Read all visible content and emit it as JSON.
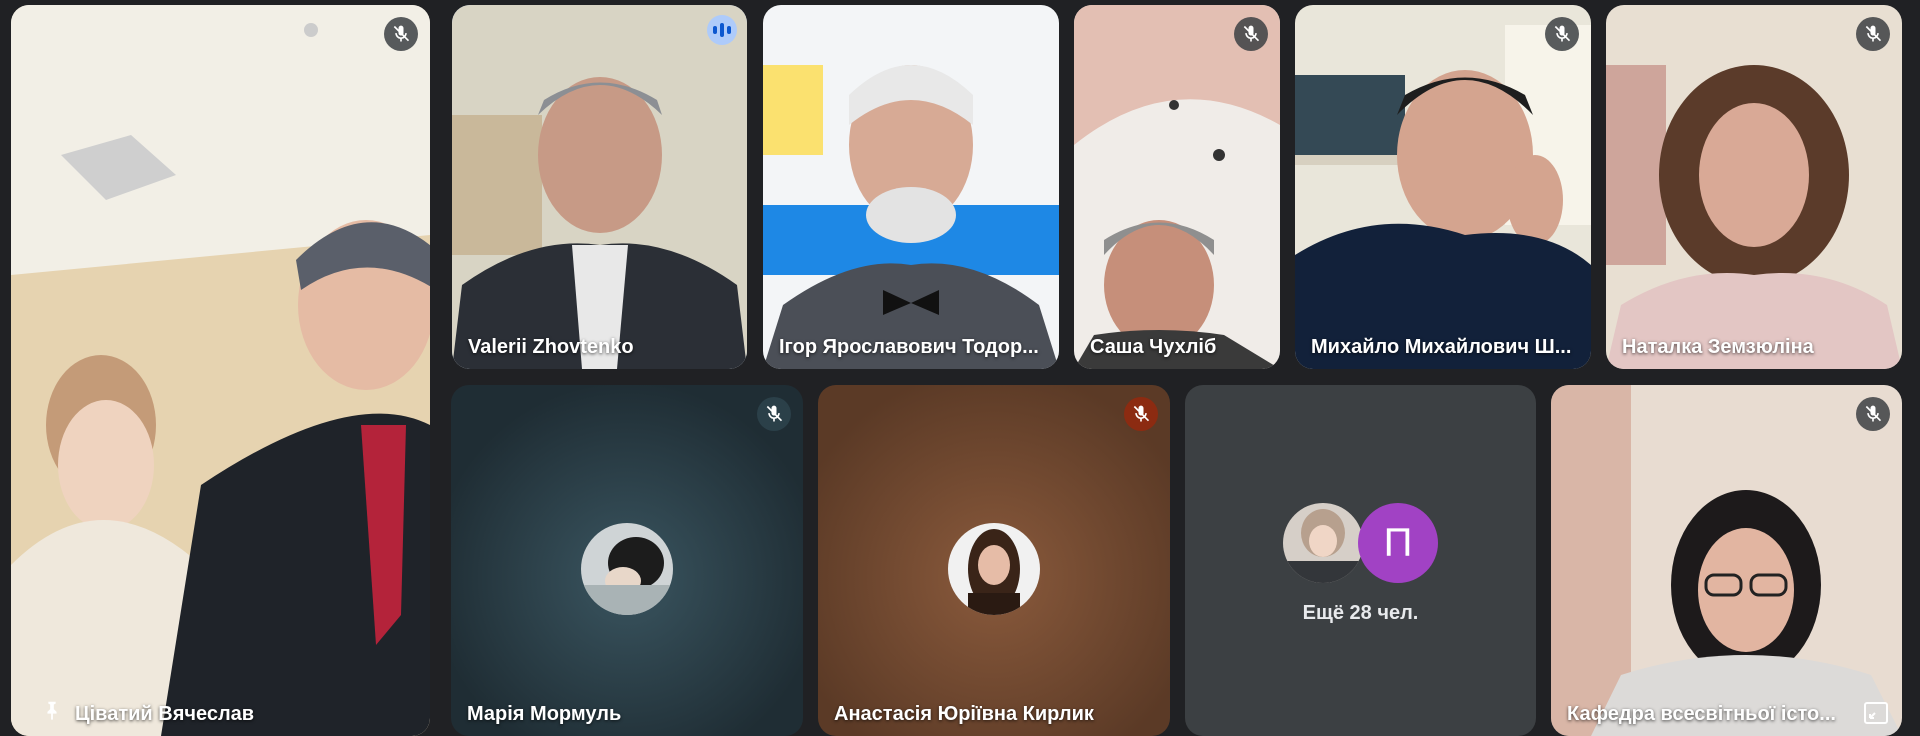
{
  "participants": [
    {
      "name": "Цiватий Вячеслав",
      "muted": true,
      "pinned": true
    },
    {
      "name": "Valerii Zhovtenko",
      "muted": false,
      "speaking": true
    },
    {
      "name": "Ігор Ярославович Тодор...",
      "muted": false
    },
    {
      "name": "Саша Чухліб",
      "muted": true
    },
    {
      "name": "Михайло Михайлович Ш...",
      "muted": true
    },
    {
      "name": "Наталка Земзюліна",
      "muted": true
    },
    {
      "name": "Марія Мормуль",
      "muted": true
    },
    {
      "name": "Анастасія Юріївна Кирлик",
      "muted": true
    },
    {
      "name": "Кафедра всесвітньої істо...",
      "muted": true
    }
  ],
  "overflow": {
    "label": "Ещё 28 чел.",
    "avatar_letter": "П",
    "avatar_color": "#a142c4"
  },
  "colors": {
    "background": "#202124",
    "active_border": "#a8c7fa",
    "muted_red": "#8c2b11"
  }
}
